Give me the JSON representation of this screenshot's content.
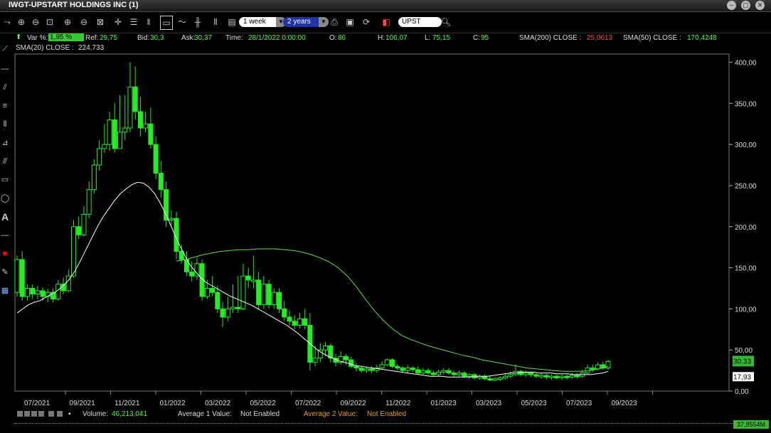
{
  "window": {
    "title": "IWGT-UPSTART HOLDINGS INC (1)"
  },
  "toolbar": {
    "period": "1 week",
    "range": "2 years",
    "symbol": "UPST"
  },
  "info": {
    "var_label": "Var %:",
    "var_value": "1,95 %",
    "ref_label": "Ref:",
    "ref_value": "29,75",
    "bid_label": "Bid:",
    "bid_value": "30,3",
    "ask_label": "Ask:",
    "ask_value": "30,37",
    "time_label": "Time:",
    "time_value": "28/1/2022 0:00:00",
    "o_label": "O:",
    "o_value": "86",
    "h_label": "H:",
    "h_value": "106,07",
    "l_label": "L:",
    "l_value": "75,15",
    "c_label": "C:",
    "c_value": "95",
    "sma200_label": "SMA(200) CLOSE :",
    "sma200_value": "25,0613",
    "sma50_label": "SMA(50) CLOSE :",
    "sma50_value": "170,4248",
    "sma20_label": "SMA(20) CLOSE :",
    "sma20_value": "224,733"
  },
  "bottom": {
    "volume_label": "Volume:",
    "volume_value": "46,213,041",
    "avg1_label": "Average 1 Value:",
    "avg1_value": "Not Enabled",
    "avg2_label": "Average 2 Value:",
    "avg2_value": "Not Enabled",
    "vol_badge": "37,8554M"
  },
  "colors": {
    "up": "#22ee22",
    "down": "#22ee22",
    "sma_white": "#ffffff",
    "sma_green": "#66dd44",
    "badge": "#33bb33"
  },
  "chart_data": {
    "type": "candlestick",
    "ylim": [
      0,
      410
    ],
    "y_ticks": [
      0,
      50,
      100,
      150,
      200,
      250,
      300,
      350,
      400
    ],
    "y_tick_labels": [
      "0,00",
      "50,00",
      "100,00",
      "150,00",
      "200,00",
      "250,00",
      "300,00",
      "350,00",
      "400,00"
    ],
    "x_tick_labels": [
      "07/2021",
      "09/2021",
      "11/2021",
      "01/2022",
      "03/2022",
      "05/2022",
      "07/2022",
      "09/2022",
      "11/2022",
      "01/2023",
      "03/2023",
      "05/2023",
      "07/2023",
      "09/2023"
    ],
    "last_price_label": "30,33",
    "sma_price_label": "17,93",
    "candles": [
      {
        "o": 120,
        "c": 160,
        "h": 165,
        "l": 115
      },
      {
        "o": 160,
        "c": 115,
        "h": 170,
        "l": 110
      },
      {
        "o": 115,
        "c": 125,
        "h": 130,
        "l": 110
      },
      {
        "o": 125,
        "c": 118,
        "h": 130,
        "l": 112
      },
      {
        "o": 118,
        "c": 122,
        "h": 128,
        "l": 112
      },
      {
        "o": 122,
        "c": 115,
        "h": 126,
        "l": 110
      },
      {
        "o": 115,
        "c": 120,
        "h": 124,
        "l": 108
      },
      {
        "o": 120,
        "c": 112,
        "h": 125,
        "l": 108
      },
      {
        "o": 112,
        "c": 130,
        "h": 135,
        "l": 110
      },
      {
        "o": 130,
        "c": 122,
        "h": 138,
        "l": 118
      },
      {
        "o": 122,
        "c": 140,
        "h": 148,
        "l": 120
      },
      {
        "o": 140,
        "c": 200,
        "h": 208,
        "l": 138
      },
      {
        "o": 200,
        "c": 190,
        "h": 212,
        "l": 185
      },
      {
        "o": 190,
        "c": 215,
        "h": 225,
        "l": 188
      },
      {
        "o": 215,
        "c": 245,
        "h": 255,
        "l": 210
      },
      {
        "o": 245,
        "c": 275,
        "h": 282,
        "l": 240
      },
      {
        "o": 275,
        "c": 295,
        "h": 305,
        "l": 268
      },
      {
        "o": 295,
        "c": 300,
        "h": 325,
        "l": 290
      },
      {
        "o": 300,
        "c": 330,
        "h": 340,
        "l": 292
      },
      {
        "o": 330,
        "c": 295,
        "h": 350,
        "l": 290
      },
      {
        "o": 295,
        "c": 315,
        "h": 360,
        "l": 300
      },
      {
        "o": 315,
        "c": 320,
        "h": 360,
        "l": 305
      },
      {
        "o": 320,
        "c": 370,
        "h": 400,
        "l": 315
      },
      {
        "o": 370,
        "c": 340,
        "h": 395,
        "l": 330
      },
      {
        "o": 340,
        "c": 320,
        "h": 358,
        "l": 310
      },
      {
        "o": 320,
        "c": 325,
        "h": 340,
        "l": 315
      },
      {
        "o": 325,
        "c": 300,
        "h": 345,
        "l": 295
      },
      {
        "o": 300,
        "c": 265,
        "h": 310,
        "l": 258
      },
      {
        "o": 265,
        "c": 245,
        "h": 280,
        "l": 235
      },
      {
        "o": 245,
        "c": 208,
        "h": 255,
        "l": 200
      },
      {
        "o": 208,
        "c": 210,
        "h": 220,
        "l": 200
      },
      {
        "o": 210,
        "c": 170,
        "h": 218,
        "l": 160
      },
      {
        "o": 170,
        "c": 160,
        "h": 178,
        "l": 155
      },
      {
        "o": 160,
        "c": 145,
        "h": 170,
        "l": 140
      },
      {
        "o": 145,
        "c": 140,
        "h": 158,
        "l": 133
      },
      {
        "o": 140,
        "c": 155,
        "h": 162,
        "l": 135
      },
      {
        "o": 155,
        "c": 115,
        "h": 160,
        "l": 110
      },
      {
        "o": 115,
        "c": 125,
        "h": 135,
        "l": 112
      },
      {
        "o": 125,
        "c": 120,
        "h": 140,
        "l": 115
      },
      {
        "o": 120,
        "c": 100,
        "h": 128,
        "l": 95
      },
      {
        "o": 100,
        "c": 90,
        "h": 108,
        "l": 78
      },
      {
        "o": 90,
        "c": 100,
        "h": 115,
        "l": 85
      },
      {
        "o": 100,
        "c": 102,
        "h": 130,
        "l": 95
      },
      {
        "o": 102,
        "c": 100,
        "h": 140,
        "l": 95
      },
      {
        "o": 100,
        "c": 140,
        "h": 155,
        "l": 98
      },
      {
        "o": 140,
        "c": 135,
        "h": 150,
        "l": 125
      },
      {
        "o": 135,
        "c": 135,
        "h": 165,
        "l": 125
      },
      {
        "o": 135,
        "c": 105,
        "h": 145,
        "l": 100
      },
      {
        "o": 105,
        "c": 130,
        "h": 140,
        "l": 100
      },
      {
        "o": 130,
        "c": 105,
        "h": 135,
        "l": 100
      },
      {
        "o": 105,
        "c": 120,
        "h": 125,
        "l": 100
      },
      {
        "o": 120,
        "c": 100,
        "h": 125,
        "l": 95
      },
      {
        "o": 100,
        "c": 90,
        "h": 110,
        "l": 85
      },
      {
        "o": 90,
        "c": 85,
        "h": 98,
        "l": 80
      },
      {
        "o": 85,
        "c": 80,
        "h": 92,
        "l": 75
      },
      {
        "o": 80,
        "c": 88,
        "h": 95,
        "l": 76
      },
      {
        "o": 88,
        "c": 80,
        "h": 100,
        "l": 75
      },
      {
        "o": 80,
        "c": 35,
        "h": 95,
        "l": 25
      },
      {
        "o": 35,
        "c": 40,
        "h": 55,
        "l": 30
      },
      {
        "o": 40,
        "c": 50,
        "h": 58,
        "l": 35
      },
      {
        "o": 50,
        "c": 55,
        "h": 60,
        "l": 42
      },
      {
        "o": 55,
        "c": 40,
        "h": 58,
        "l": 35
      },
      {
        "o": 40,
        "c": 35,
        "h": 45,
        "l": 30
      },
      {
        "o": 35,
        "c": 42,
        "h": 48,
        "l": 32
      },
      {
        "o": 42,
        "c": 38,
        "h": 45,
        "l": 32
      },
      {
        "o": 38,
        "c": 30,
        "h": 42,
        "l": 28
      },
      {
        "o": 30,
        "c": 28,
        "h": 34,
        "l": 24
      },
      {
        "o": 28,
        "c": 25,
        "h": 30,
        "l": 22
      },
      {
        "o": 25,
        "c": 27,
        "h": 30,
        "l": 22
      },
      {
        "o": 27,
        "c": 25,
        "h": 30,
        "l": 22
      },
      {
        "o": 25,
        "c": 28,
        "h": 32,
        "l": 22
      },
      {
        "o": 28,
        "c": 32,
        "h": 36,
        "l": 26
      },
      {
        "o": 32,
        "c": 38,
        "h": 40,
        "l": 30
      },
      {
        "o": 38,
        "c": 30,
        "h": 40,
        "l": 28
      },
      {
        "o": 30,
        "c": 28,
        "h": 33,
        "l": 25
      },
      {
        "o": 28,
        "c": 25,
        "h": 30,
        "l": 22
      },
      {
        "o": 25,
        "c": 28,
        "h": 32,
        "l": 22
      },
      {
        "o": 28,
        "c": 26,
        "h": 30,
        "l": 23
      },
      {
        "o": 26,
        "c": 22,
        "h": 30,
        "l": 20
      },
      {
        "o": 22,
        "c": 25,
        "h": 28,
        "l": 20
      },
      {
        "o": 25,
        "c": 22,
        "h": 28,
        "l": 20
      },
      {
        "o": 22,
        "c": 20,
        "h": 25,
        "l": 18
      },
      {
        "o": 20,
        "c": 23,
        "h": 26,
        "l": 18
      },
      {
        "o": 23,
        "c": 25,
        "h": 28,
        "l": 20
      },
      {
        "o": 25,
        "c": 22,
        "h": 28,
        "l": 20
      },
      {
        "o": 22,
        "c": 20,
        "h": 25,
        "l": 17
      },
      {
        "o": 20,
        "c": 22,
        "h": 25,
        "l": 17
      },
      {
        "o": 22,
        "c": 18,
        "h": 24,
        "l": 16
      },
      {
        "o": 18,
        "c": 20,
        "h": 22,
        "l": 15
      },
      {
        "o": 20,
        "c": 16,
        "h": 22,
        "l": 14
      },
      {
        "o": 16,
        "c": 18,
        "h": 20,
        "l": 14
      },
      {
        "o": 18,
        "c": 15,
        "h": 20,
        "l": 13
      },
      {
        "o": 15,
        "c": 14,
        "h": 18,
        "l": 12
      },
      {
        "o": 14,
        "c": 15,
        "h": 17,
        "l": 12
      },
      {
        "o": 15,
        "c": 16,
        "h": 18,
        "l": 12
      },
      {
        "o": 16,
        "c": 18,
        "h": 22,
        "l": 14
      },
      {
        "o": 18,
        "c": 20,
        "h": 24,
        "l": 16
      },
      {
        "o": 20,
        "c": 24,
        "h": 32,
        "l": 18
      },
      {
        "o": 24,
        "c": 20,
        "h": 26,
        "l": 18
      },
      {
        "o": 20,
        "c": 22,
        "h": 25,
        "l": 17
      },
      {
        "o": 22,
        "c": 20,
        "h": 24,
        "l": 17
      },
      {
        "o": 20,
        "c": 18,
        "h": 22,
        "l": 16
      },
      {
        "o": 18,
        "c": 19,
        "h": 22,
        "l": 15
      },
      {
        "o": 19,
        "c": 17,
        "h": 21,
        "l": 14
      },
      {
        "o": 17,
        "c": 18,
        "h": 20,
        "l": 14
      },
      {
        "o": 18,
        "c": 16,
        "h": 20,
        "l": 14
      },
      {
        "o": 16,
        "c": 18,
        "h": 20,
        "l": 14
      },
      {
        "o": 18,
        "c": 17,
        "h": 20,
        "l": 14
      },
      {
        "o": 17,
        "c": 19,
        "h": 22,
        "l": 15
      },
      {
        "o": 19,
        "c": 18,
        "h": 22,
        "l": 15
      },
      {
        "o": 18,
        "c": 22,
        "h": 26,
        "l": 16
      },
      {
        "o": 22,
        "c": 28,
        "h": 32,
        "l": 20
      },
      {
        "o": 28,
        "c": 27,
        "h": 32,
        "l": 23
      },
      {
        "o": 27,
        "c": 32,
        "h": 35,
        "l": 25
      },
      {
        "o": 32,
        "c": 28,
        "h": 36,
        "l": 26
      },
      {
        "o": 28,
        "c": 36,
        "h": 38,
        "l": 26
      }
    ],
    "sma_white": [
      95,
      100,
      105,
      108,
      110,
      114,
      118,
      122,
      128,
      135,
      145,
      158,
      172,
      186,
      200,
      212,
      222,
      232,
      240,
      246,
      251,
      254,
      253,
      248,
      240,
      228,
      214,
      198,
      182,
      168,
      155,
      146,
      138,
      132,
      128,
      124,
      120,
      116,
      113,
      110,
      107,
      104,
      100,
      96,
      92,
      88,
      84,
      80,
      75,
      70,
      64,
      58,
      52,
      47,
      43,
      40,
      37,
      35,
      33,
      31,
      30,
      29,
      28,
      27,
      26,
      25,
      24,
      23,
      22,
      21,
      20,
      19,
      18,
      18,
      18,
      17,
      17,
      17,
      17,
      17,
      18,
      18,
      18,
      19,
      20,
      21,
      22,
      22,
      23,
      23,
      23,
      22,
      22,
      22,
      21,
      21,
      21,
      20,
      20,
      20,
      20,
      21,
      22,
      24
    ],
    "sma_green": [
      158,
      160,
      163,
      166,
      168,
      170,
      171,
      172,
      172,
      173,
      173,
      173,
      172,
      171,
      169,
      166,
      162,
      157,
      150,
      140,
      127,
      112,
      98,
      86,
      76,
      68,
      63,
      59,
      55,
      52,
      49,
      46,
      43,
      41,
      38,
      36,
      34,
      32,
      30,
      28,
      27,
      26,
      25,
      24,
      24,
      24,
      25,
      27,
      30
    ]
  }
}
